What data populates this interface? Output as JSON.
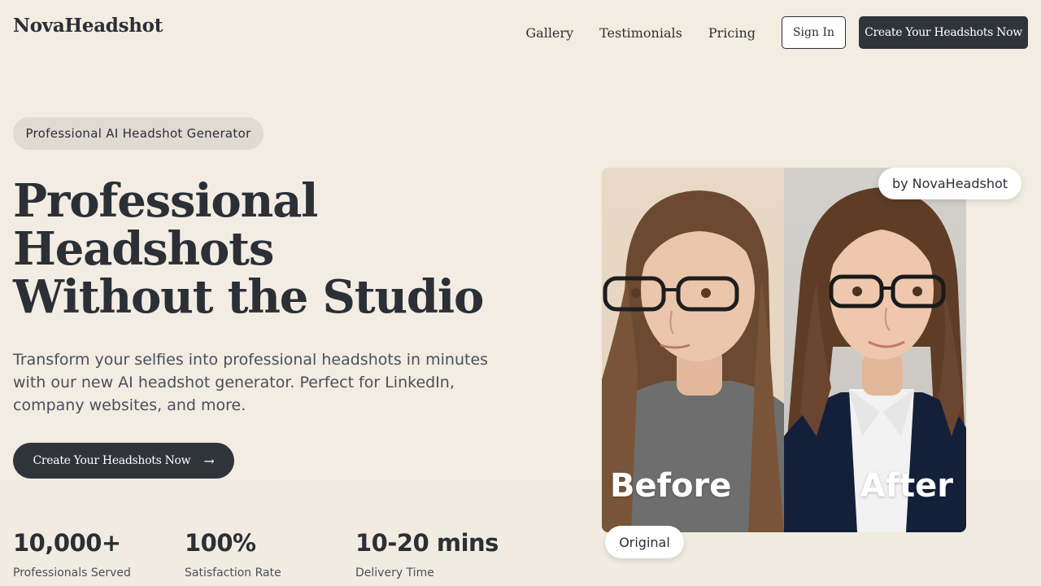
{
  "header": {
    "logo": "NovaHeadshot",
    "nav": [
      "Gallery",
      "Testimonials",
      "Pricing"
    ],
    "signin_label": "Sign In",
    "cta_label": "Create Your Headshots Now"
  },
  "hero": {
    "pill": "Professional AI Headshot Generator",
    "headline": [
      "Professional",
      "Headshots",
      "Without the Studio"
    ],
    "subtext": "Transform your selfies into professional headshots in minutes with our new AI headshot generator. Perfect for LinkedIn, company websites, and more.",
    "cta_label": "Create Your Headshots Now",
    "cta_icon": "arrow-right-icon"
  },
  "stats": [
    {
      "value": "10,000+",
      "label": "Professionals Served"
    },
    {
      "value": "100%",
      "label": "Satisfaction Rate"
    },
    {
      "value": "10-20 mins",
      "label": "Delivery Time"
    }
  ],
  "comparison": {
    "before_label": "Before",
    "after_label": "After",
    "badge_by": "by NovaHeadshot",
    "badge_original": "Original"
  },
  "colors": {
    "background": "#f3ece2",
    "primary_dark": "#2f333a",
    "pill_bg": "#e1dad1"
  }
}
